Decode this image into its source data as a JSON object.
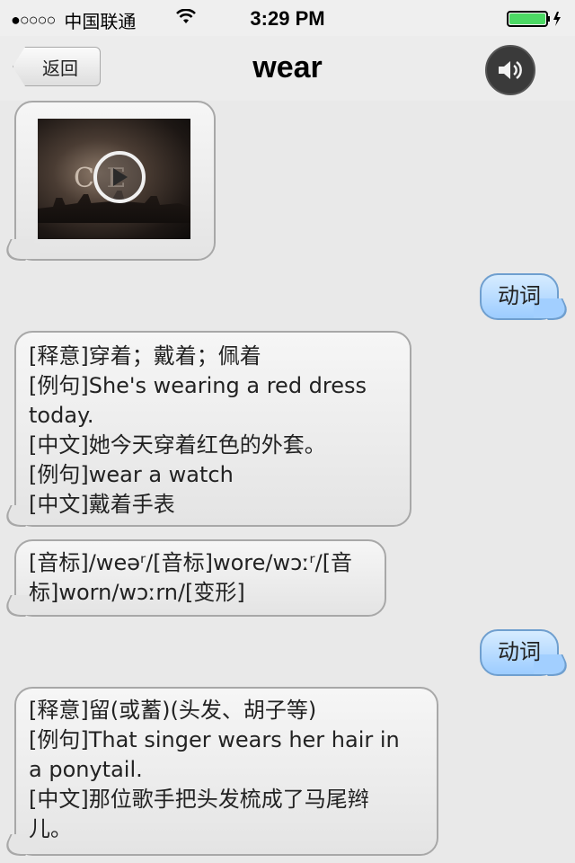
{
  "status_bar": {
    "signal_dots": "●○○○○",
    "carrier": "中国联通",
    "time": "3:29 PM",
    "battery_color": "#4cd964"
  },
  "nav": {
    "back_label": "返回",
    "title": "wear",
    "speaker_icon": "speaker-icon"
  },
  "video": {
    "thumb_text": "C   E",
    "play_icon": "play-icon"
  },
  "messages": [
    {
      "type": "tag",
      "text": "动词"
    },
    {
      "type": "definition",
      "lines": [
        "[释意]穿着；戴着；佩着",
        "[例句]She's wearing a red dress",
        "today.",
        "[中文]她今天穿着红色的外套。",
        "[例句]wear a watch",
        "[中文]戴着手表"
      ]
    },
    {
      "type": "phonetic",
      "lines": [
        "[音标]/weəʳ/[音标]wore/wɔːʳ/[音",
        "标]worn/wɔːrn/[变形]"
      ]
    },
    {
      "type": "tag",
      "text": "动词"
    },
    {
      "type": "definition",
      "lines": [
        "[释意]留(或蓄)(头发、胡子等)",
        "[例句]That singer wears her hair in",
        "a ponytail.",
        "[中文]那位歌手把头发梳成了马尾辫",
        "儿。"
      ]
    }
  ]
}
